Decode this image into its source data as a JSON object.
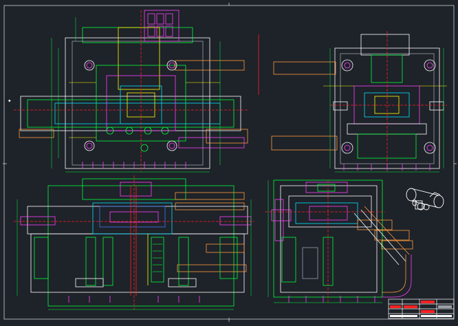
{
  "drawing": {
    "background": "#1e2229",
    "colors": {
      "white": "#ffffff",
      "grey": "#9aa0a8",
      "green": "#00ff3c",
      "magenta": "#ff40ff",
      "yellow": "#ffff00",
      "red": "#ff2020",
      "cyan": "#00e5ff",
      "blue": "#3a7bff",
      "orange": "#ff9b3a"
    },
    "views": [
      {
        "name": "top-left-plan-view"
      },
      {
        "name": "top-right-end-view"
      },
      {
        "name": "bottom-left-section-view"
      },
      {
        "name": "bottom-right-section-view"
      },
      {
        "name": "isometric-part-view"
      }
    ],
    "title_block": {
      "rows": 4
    }
  }
}
